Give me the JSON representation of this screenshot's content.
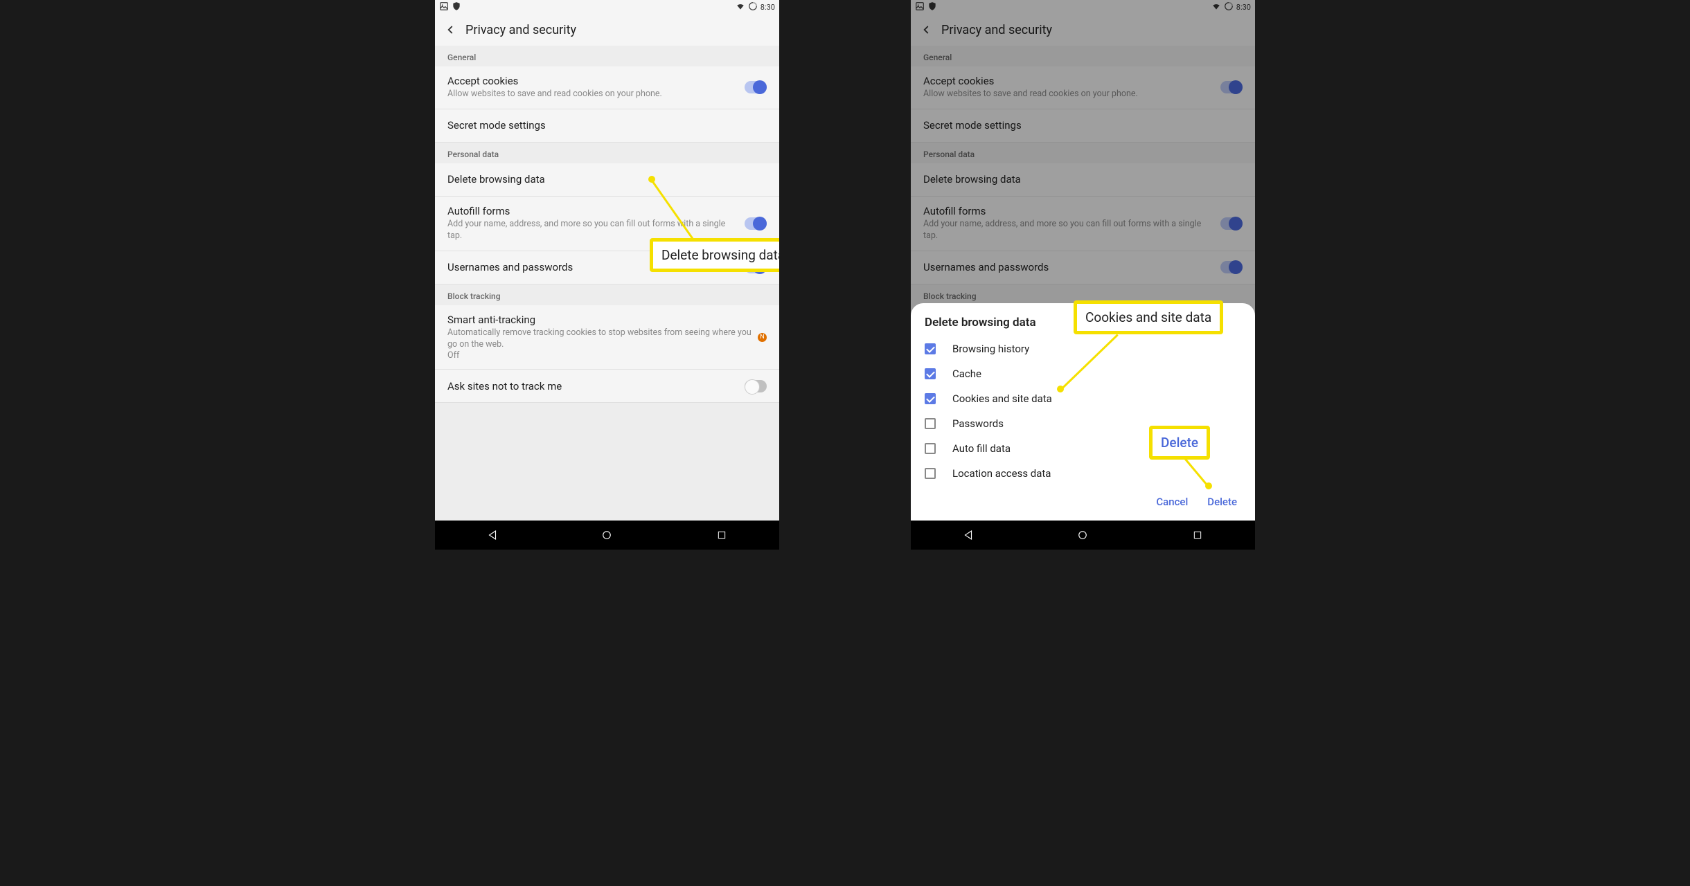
{
  "status": {
    "time": "8:30"
  },
  "header": {
    "title": "Privacy and security"
  },
  "sections": {
    "general": {
      "label": "General"
    },
    "personal": {
      "label": "Personal data"
    },
    "block": {
      "label": "Block tracking"
    }
  },
  "items": {
    "accept_cookies": {
      "title": "Accept cookies",
      "sub": "Allow websites to save and read cookies on your phone."
    },
    "secret_mode": {
      "title": "Secret mode settings"
    },
    "delete_browsing": {
      "title": "Delete browsing data"
    },
    "autofill": {
      "title": "Autofill forms",
      "sub": "Add your name, address, and more so you can fill out forms with a single tap."
    },
    "usernames": {
      "title": "Usernames and passwords"
    },
    "smart_tracking": {
      "title": "Smart anti-tracking",
      "sub": "Automatically remove tracking cookies to stop websites from seeing where you go on the web.",
      "state": "Off",
      "badge": "N"
    },
    "ask_sites": {
      "title": "Ask sites not to track me"
    }
  },
  "dialog": {
    "title": "Delete browsing data",
    "options": {
      "browsing_history": "Browsing history",
      "cache": "Cache",
      "cookies": "Cookies and site data",
      "passwords": "Passwords",
      "autofill": "Auto fill data",
      "location": "Location access data"
    },
    "actions": {
      "cancel": "Cancel",
      "delete": "Delete"
    }
  },
  "callouts": {
    "delete_browsing": "Delete browsing data",
    "cookies": "Cookies and site data",
    "delete_btn": "Delete"
  }
}
